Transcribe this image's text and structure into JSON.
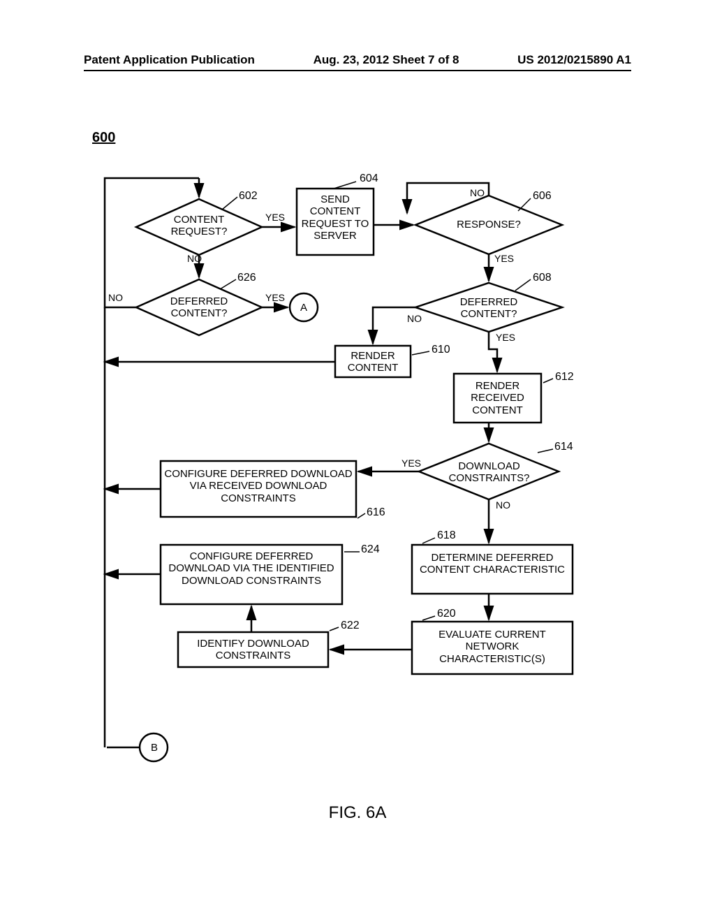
{
  "header": {
    "left": "Patent Application Publication",
    "center": "Aug. 23, 2012  Sheet 7 of 8",
    "right": "US 2012/0215890 A1"
  },
  "figure": {
    "number": "600",
    "label": "FIG. 6A"
  },
  "refs": {
    "r602": "602",
    "r604": "604",
    "r606": "606",
    "r608": "608",
    "r610": "610",
    "r612": "612",
    "r614": "614",
    "r616": "616",
    "r618": "618",
    "r620": "620",
    "r622": "622",
    "r624": "624",
    "r626": "626"
  },
  "edges": {
    "yes": "YES",
    "no": "NO"
  },
  "nodes": {
    "n602": "CONTENT REQUEST?",
    "n604": "SEND CONTENT REQUEST TO SERVER",
    "n606": "RESPONSE?",
    "n608": "DEFERRED CONTENT?",
    "n610": "RENDER CONTENT",
    "n612": "RENDER RECEIVED CONTENT",
    "n614": "DOWNLOAD CONSTRAINTS?",
    "n616": "CONFIGURE DEFERRED DOWNLOAD VIA RECEIVED DOWNLOAD CONSTRAINTS",
    "n618": "DETERMINE DEFERRED CONTENT CHARACTERISTIC",
    "n620": "EVALUATE CURRENT NETWORK CHARACTERISTIC(S)",
    "n622": "IDENTIFY DOWNLOAD CONSTRAINTS",
    "n624": "CONFIGURE DEFERRED DOWNLOAD VIA THE IDENTIFIED DOWNLOAD CONSTRAINTS",
    "connA": "A",
    "connB": "B"
  }
}
